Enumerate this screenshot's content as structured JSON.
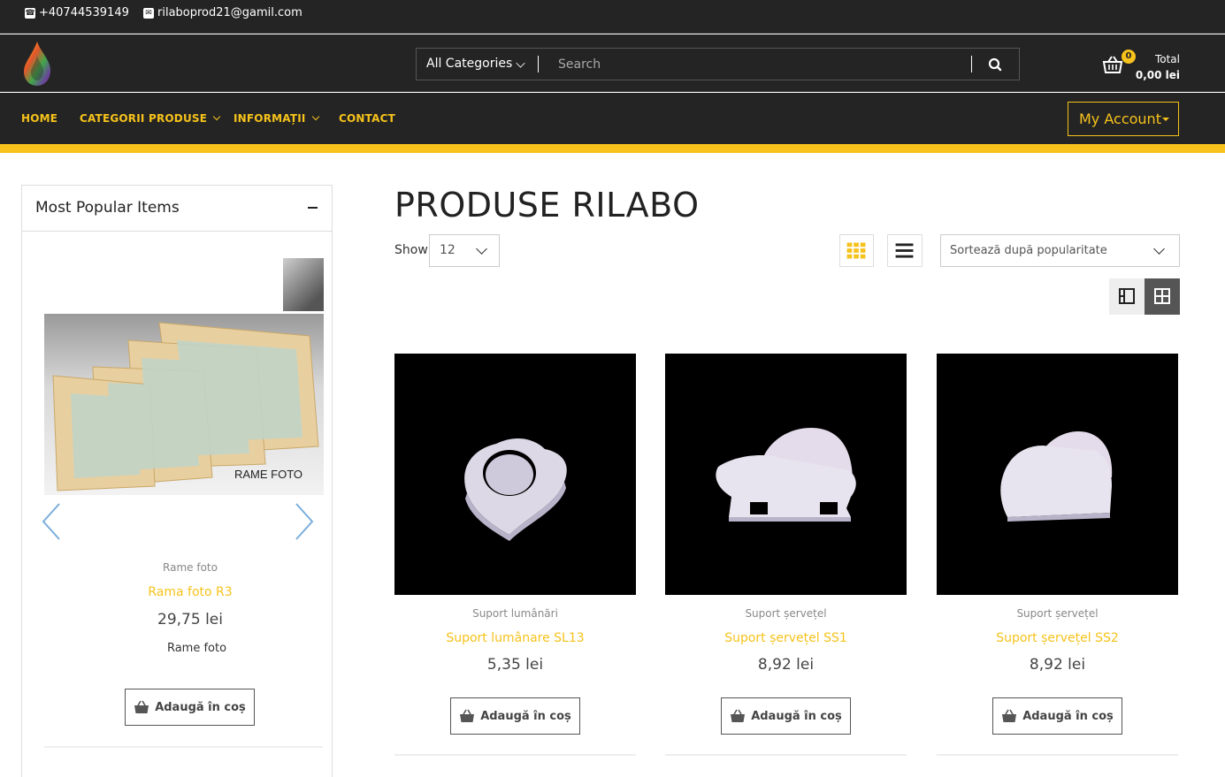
{
  "topbar": {
    "phone": "+40744539149",
    "email": "rilaboprod21@gamil.com"
  },
  "header": {
    "search_category": "All Categories",
    "search_placeholder": "Search",
    "cart_count": "0",
    "total_label": "Total",
    "total_value": "0,00 lei"
  },
  "nav": {
    "items": [
      "HOME",
      "CATEGORII PRODUSE",
      "INFORMAȚII",
      "CONTACT"
    ],
    "my_account": "My Account"
  },
  "colors": {
    "accent": "#f6c21b",
    "dark": "#242424"
  },
  "sidebar": {
    "title": "Most Popular Items",
    "image_caption": "RAME FOTO",
    "product": {
      "category": "Rame foto",
      "name": "Rama foto R3",
      "price": "29,75 lei",
      "tag": "Rame foto",
      "add_label": "Adaugă în coș"
    }
  },
  "main": {
    "title": "PRODUSE RILABO",
    "show_label": "Show",
    "show_value": "12",
    "sort_value": "Sortează după popularitate",
    "products": [
      {
        "category": "Suport lumânări",
        "name": "Suport lumânare SL13",
        "price": "5,35 lei",
        "add_label": "Adaugă în coș"
      },
      {
        "category": "Suport șervețel",
        "name": "Suport șervețel SS1",
        "price": "8,92 lei",
        "add_label": "Adaugă în coș"
      },
      {
        "category": "Suport șervețel",
        "name": "Suport șervețel SS2",
        "price": "8,92 lei",
        "add_label": "Adaugă în coș"
      }
    ]
  }
}
